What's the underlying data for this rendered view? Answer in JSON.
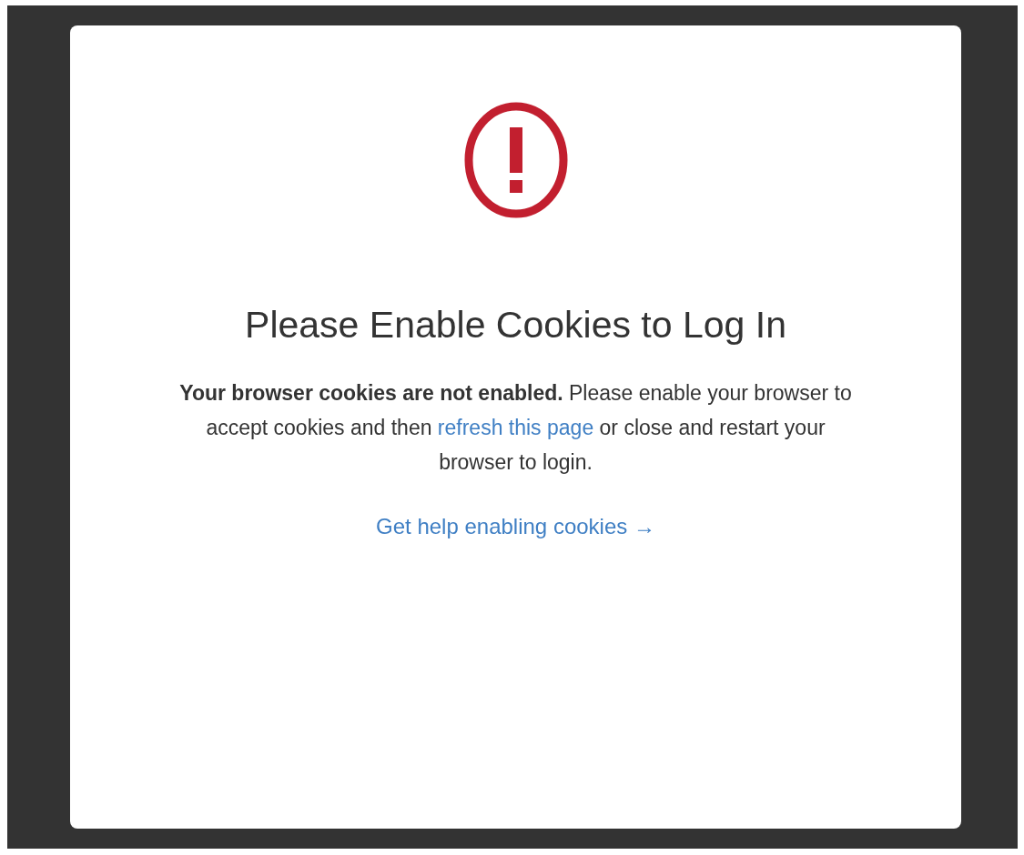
{
  "title": "Please Enable Cookies to Log In",
  "message": {
    "text": "**Your browser cookies are not enabled.** Please enable your browser to accept cookies and then",
    "link": "refresh this page",
    "after": "or close and restart your browser to login."
  },
  "help_link": "Get help enabling cookies →"
}
